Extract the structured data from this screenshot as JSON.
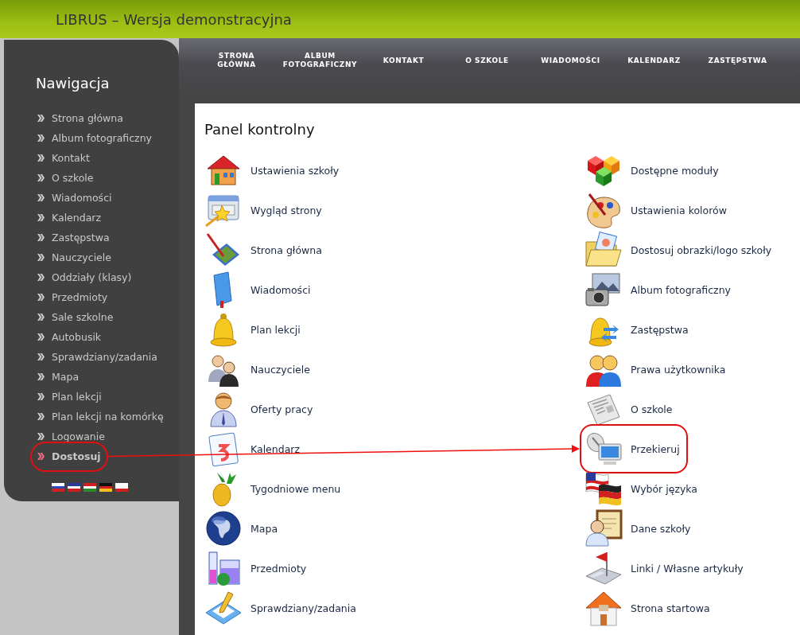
{
  "header": {
    "title": "LIBRUS – Wersja demonstracyjna"
  },
  "top_nav": [
    {
      "label": "STRONA\nGŁÓWNA"
    },
    {
      "label": "ALBUM\nFOTOGRAFICZNY"
    },
    {
      "label": "KONTAKT"
    },
    {
      "label": "O SZKOLE"
    },
    {
      "label": "WIADOMOŚCI"
    },
    {
      "label": "KALENDARZ"
    },
    {
      "label": "ZASTĘPSTWA"
    }
  ],
  "sidebar": {
    "title": "Nawigacja",
    "items": [
      {
        "label": "Strona główna",
        "selected": false,
        "highlighted": false
      },
      {
        "label": "Album fotograficzny",
        "selected": false,
        "highlighted": false
      },
      {
        "label": "Kontakt",
        "selected": false,
        "highlighted": false
      },
      {
        "label": "O szkole",
        "selected": false,
        "highlighted": false
      },
      {
        "label": "Wiadomości",
        "selected": false,
        "highlighted": false
      },
      {
        "label": "Kalendarz",
        "selected": false,
        "highlighted": false
      },
      {
        "label": "Zastępstwa",
        "selected": false,
        "highlighted": false
      },
      {
        "label": "Nauczyciele",
        "selected": false,
        "highlighted": false
      },
      {
        "label": "Oddziały (klasy)",
        "selected": false,
        "highlighted": false
      },
      {
        "label": "Przedmioty",
        "selected": false,
        "highlighted": false
      },
      {
        "label": "Sale szkolne",
        "selected": false,
        "highlighted": false
      },
      {
        "label": "Autobusik",
        "selected": false,
        "highlighted": false
      },
      {
        "label": "Sprawdziany/zadania",
        "selected": false,
        "highlighted": false
      },
      {
        "label": "Mapa",
        "selected": false,
        "highlighted": false
      },
      {
        "label": "Plan lekcji",
        "selected": false,
        "highlighted": false
      },
      {
        "label": "Plan lekcji na komórkę",
        "selected": false,
        "highlighted": false
      },
      {
        "label": "Logowanie",
        "selected": false,
        "highlighted": false
      },
      {
        "label": "Dostosuj",
        "selected": true,
        "highlighted": true
      }
    ]
  },
  "panel": {
    "title": "Panel kontrolny",
    "columns": [
      [
        {
          "label": "Ustawienia szkoły",
          "kind": "house",
          "highlighted": false
        },
        {
          "label": "Wygląd strony",
          "kind": "window-wand",
          "highlighted": false
        },
        {
          "label": "Strona główna",
          "kind": "brush-picture",
          "highlighted": false
        },
        {
          "label": "Wiadomości",
          "kind": "book",
          "highlighted": false
        },
        {
          "label": "Plan lekcji",
          "kind": "bell",
          "highlighted": false
        },
        {
          "label": "Nauczyciele",
          "kind": "people",
          "highlighted": false
        },
        {
          "label": "Oferty pracy",
          "kind": "person",
          "highlighted": false
        },
        {
          "label": "Kalendarz",
          "kind": "calendar",
          "highlighted": false
        },
        {
          "label": "Tygodniowe menu",
          "kind": "pineapple",
          "highlighted": false
        },
        {
          "label": "Mapa",
          "kind": "globe",
          "highlighted": false
        },
        {
          "label": "Przedmioty",
          "kind": "beakers",
          "highlighted": false
        },
        {
          "label": "Sprawdziany/zadania",
          "kind": "pencil-paper",
          "highlighted": false
        }
      ],
      [
        {
          "label": "Dostępne moduły",
          "kind": "cubes",
          "highlighted": false
        },
        {
          "label": "Ustawienia kolorów",
          "kind": "palette",
          "highlighted": false
        },
        {
          "label": "Dostosuj obrazki/logo szkoły",
          "kind": "folder-picture",
          "highlighted": false
        },
        {
          "label": "Album fotograficzny",
          "kind": "camera",
          "highlighted": false
        },
        {
          "label": "Zastępstwa",
          "kind": "bell-arrows",
          "highlighted": false
        },
        {
          "label": "Prawa użytkownika",
          "kind": "users",
          "highlighted": false
        },
        {
          "label": "O szkole",
          "kind": "newspaper",
          "highlighted": false
        },
        {
          "label": "Przekieruj",
          "kind": "satellite-monitor",
          "highlighted": true
        },
        {
          "label": "Wybór języka",
          "kind": "flags",
          "highlighted": false
        },
        {
          "label": "Dane szkoły",
          "kind": "certificate-person",
          "highlighted": false
        },
        {
          "label": "Linki / Własne artykuły",
          "kind": "flag-pin",
          "highlighted": false
        },
        {
          "label": "Strona startowa",
          "kind": "house-orange",
          "highlighted": false
        }
      ]
    ]
  }
}
